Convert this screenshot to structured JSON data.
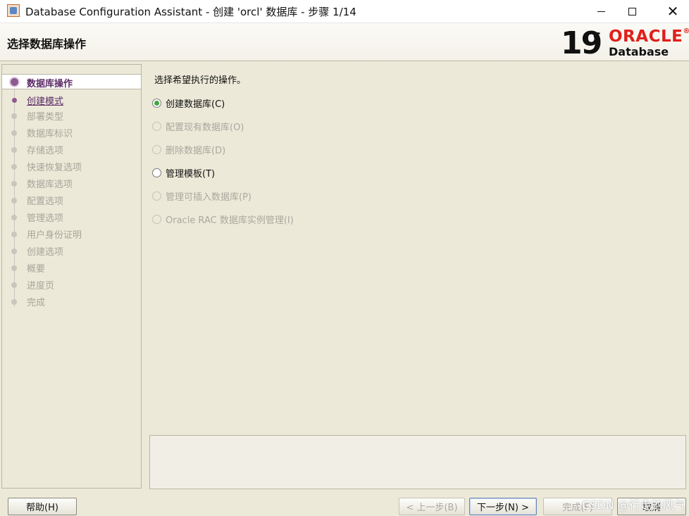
{
  "window": {
    "title": "Database Configuration Assistant - 创建 'orcl' 数据库 - 步骤 1/14",
    "controls": [
      "minimize-icon",
      "maximize-icon",
      "close-icon"
    ],
    "close_glyph": "✕"
  },
  "header": {
    "title": "选择数据库操作",
    "logo": {
      "version": "19",
      "superscript": "c",
      "brand": "ORACLE",
      "registered": "®",
      "product": "Database"
    }
  },
  "sidebar": {
    "steps": [
      {
        "label": "数据库操作",
        "state": "active"
      },
      {
        "label": "创建模式",
        "state": "done"
      },
      {
        "label": "部署类型",
        "state": "pending"
      },
      {
        "label": "数据库标识",
        "state": "pending"
      },
      {
        "label": "存储选项",
        "state": "pending"
      },
      {
        "label": "快速恢复选项",
        "state": "pending"
      },
      {
        "label": "数据库选项",
        "state": "pending"
      },
      {
        "label": "配置选项",
        "state": "pending"
      },
      {
        "label": "管理选项",
        "state": "pending"
      },
      {
        "label": "用户身份证明",
        "state": "pending"
      },
      {
        "label": "创建选项",
        "state": "pending"
      },
      {
        "label": "概要",
        "state": "pending"
      },
      {
        "label": "进度页",
        "state": "pending"
      },
      {
        "label": "完成",
        "state": "pending"
      }
    ]
  },
  "main": {
    "prompt": "选择希望执行的操作。",
    "options": [
      {
        "label": "创建数据库(C)",
        "checked": true,
        "enabled": true
      },
      {
        "label": "配置现有数据库(O)",
        "checked": false,
        "enabled": false
      },
      {
        "label": "删除数据库(D)",
        "checked": false,
        "enabled": false
      },
      {
        "label": "管理模板(T)",
        "checked": false,
        "enabled": true
      },
      {
        "label": "管理可插入数据库(P)",
        "checked": false,
        "enabled": false
      },
      {
        "label": "Oracle RAC 数据库实例管理(I)",
        "checked": false,
        "enabled": false
      }
    ]
  },
  "footer": {
    "help": "帮助(H)",
    "back": "< 上一步(B)",
    "next": "下一步(N) >",
    "finish": "完成(F)",
    "cancel": "取消"
  },
  "watermark": "CSDN @行走的风气",
  "colors": {
    "accent_purple": "#5b2b66",
    "radio_checked": "#44a542",
    "oracle_red": "#e0201b",
    "panel_bg": "#ece9d8"
  }
}
